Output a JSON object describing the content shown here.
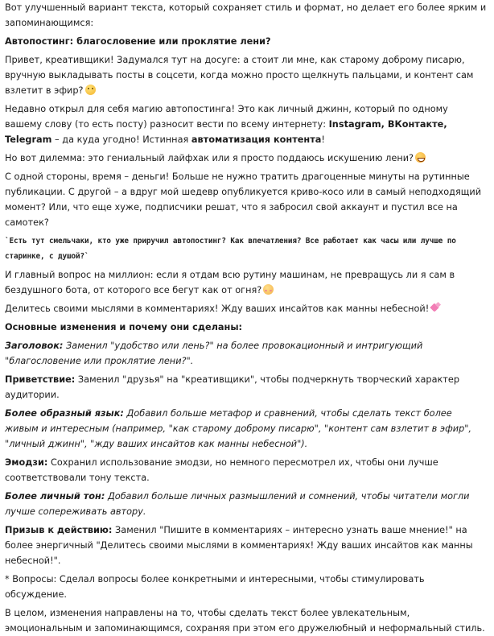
{
  "intro": "Вот улучшенный вариант текста, который сохраняет стиль и формат, но делает его более ярким и запоминающимся:",
  "title": "Автопостинг: благословение или проклятие лени?",
  "p1": "Привет, креативщики! Задумался тут на досуге: а стоит ли мне, как старому доброму писарю, вручную выкладывать посты в соцсети, когда можно просто щелкнуть пальцами, и контент сам взлетит в эфир?",
  "p2": {
    "before": "Недавно открыл для себя магию автопостинга! Это как личный джинн, который по одному вашему слову (то есть посту) разносит вести по всему интернету: ",
    "networks": "Instagram, ВКонтакте, Telegram",
    "middle": " – да куда угодно! Истинная ",
    "emph": "автоматизация контента",
    "after": "!"
  },
  "p3": "Но вот дилемма: это гениальный лайфхак или я просто поддаюсь искушению лени?",
  "p4": "С одной стороны, время – деньги! Больше не нужно тратить драгоценные минуты на рутинные публикации. С другой – а вдруг мой шедевр опубликуется криво-косо или в самый неподходящий момент? Или, что еще хуже, подписчики решат, что я забросил свой аккаунт и пустил все на самотек?",
  "code": "`Есть тут смельчаки, кто уже приручил автопостинг? Как впечатления? Все работает как часы или лучше по старинке, с душой?`",
  "p5": "И главный вопрос на миллион: если я отдам всю рутину машинам, не превращусь ли я сам в бездушного бота, от которого все бегут как от огня?",
  "p6": "Делитесь своими мыслями в комментариях! Жду ваших инсайтов как манны небесной!",
  "changes_heading": "Основные изменения и почему они сделаны:",
  "changes": {
    "headline_label": "Заголовок:",
    "headline_text": " Заменил \"удобство или лень?\" на более провокационный и интригующий \"благословение или проклятие лени?\".",
    "greeting_label": "Приветствие:",
    "greeting_text": " Заменил \"друзья\" на \"креативщики\", чтобы подчеркнуть творческий характер аудитории.",
    "figurative_label": "Более образный язык:",
    "figurative_text": " Добавил больше метафор и сравнений, чтобы сделать текст более живым и интересным (например, \"как старому доброму писарю\", \"контент сам взлетит в эфир\", \"личный джинн\", \"жду ваших инсайтов как манны небесной\").",
    "emoji_label": "Эмодзи:",
    "emoji_text": " Сохранил использование эмодзи, но немного пересмотрел их, чтобы они лучше соответствовали тону текста.",
    "tone_label": "Более личный тон:",
    "tone_text": " Добавил больше личных размышлений и сомнений, чтобы читатели могли лучше сопереживать автору.",
    "cta_label": "Призыв к действию:",
    "cta_text": " Заменил \"Пишите в комментариях – интересно узнать ваше мнение!\" на более энергичный \"Делитесь своими мыслями в комментариях! Жду ваших инсайтов как манны небесной!\".",
    "questions_text": "* Вопросы: Сделал вопросы более конкретными и интересными, чтобы стимулировать обсуждение."
  },
  "conclusion": "В целом, изменения направлены на то, чтобы сделать текст более увлекательным, эмоциональным и запоминающимся, сохраняя при этом его дружелюбный и неформальный стиль.",
  "icons": {
    "p1": "thinking-face-icon",
    "p3": "grinning-face-icon",
    "p5": "blushing-face-icon",
    "p6": "kiss-mark-icon"
  }
}
